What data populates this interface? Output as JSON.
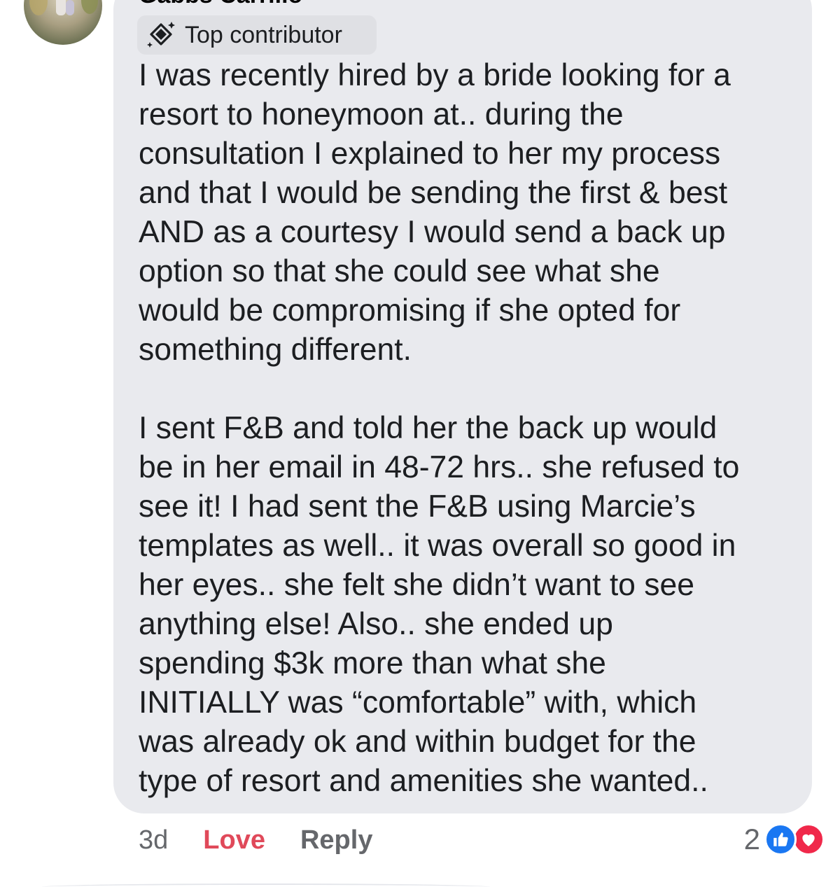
{
  "comment": {
    "author": "Gabbs Carrillo",
    "badge": "Top contributor",
    "paragraph1": [
      "I was recently hired by a bride looking for a",
      "resort to honeymoon at.. during the",
      "consultation I explained to her my process",
      "and that I would be sending the first & best",
      "AND as a courtesy I would send a back up",
      "option so that she could see what she",
      "would be compromising if she opted for",
      "something different."
    ],
    "paragraph2": [
      "I sent F&B and told her the back up would",
      "be in her email in 48-72 hrs.. she refused to",
      "see it! I had sent the F&B using Marcie’s",
      "templates as well.. it was overall so good in",
      "her eyes.. she felt she didn’t want to see",
      "anything else! Also.. she ended up",
      "spending $3k more than what she",
      "INITIALLY was “comfortable” with, which",
      "was already ok and within budget for the",
      "type of resort and amenities she wanted.."
    ],
    "timestamp": "3d",
    "love_label": "Love",
    "reply_label": "Reply",
    "reaction_count": "2",
    "reaction_icons": [
      "like-icon",
      "love-icon"
    ]
  },
  "colors": {
    "bubble": "#e9eaee",
    "love": "#e0495a",
    "like_icon": "#1a77f2",
    "love_icon": "#f0284a",
    "muted_text": "#65676b"
  }
}
